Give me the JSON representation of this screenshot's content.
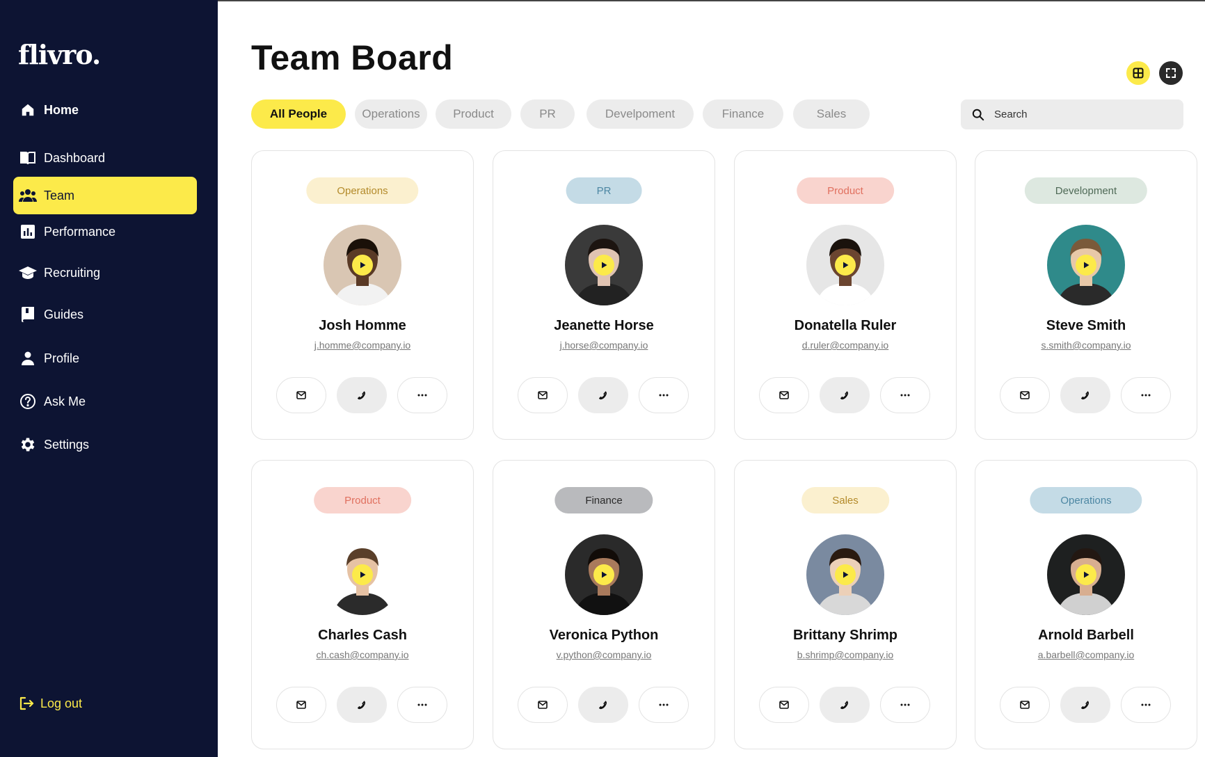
{
  "brand": {
    "logo": "flivro.",
    "accent": "#fcea4a",
    "sidebar_bg": "#0d1433"
  },
  "sidebar": {
    "items": [
      {
        "label": "Home",
        "icon": "home-icon",
        "active": false,
        "bold": true
      },
      {
        "label": "Dashboard",
        "icon": "book-open-icon",
        "active": false
      },
      {
        "label": "Team",
        "icon": "people-icon",
        "active": true
      },
      {
        "label": "Performance",
        "icon": "bar-chart-icon",
        "active": false
      },
      {
        "label": "Recruiting",
        "icon": "graduation-cap-icon",
        "active": false
      },
      {
        "label": "Guides",
        "icon": "book-icon",
        "active": false
      },
      {
        "label": "Profile",
        "icon": "person-icon",
        "active": false
      },
      {
        "label": "Ask Me",
        "icon": "question-icon",
        "active": false
      },
      {
        "label": "Settings",
        "icon": "gear-icon",
        "active": false
      }
    ],
    "logout": "Log out"
  },
  "page": {
    "title": "Team Board"
  },
  "filters": [
    "All People",
    "Operations",
    "Product",
    "PR",
    "Develpoment",
    "Finance",
    "Sales"
  ],
  "search": {
    "placeholder": "Search"
  },
  "people": [
    {
      "name": "Josh Homme",
      "email": "j.homme@company.io",
      "dept": "Operations",
      "tag_bg": "#fbf0cf",
      "tag_fg": "#b38a2a",
      "avatar_bg": "#d9c6b3",
      "skin": "#5a3a26",
      "hair": "#1a1008",
      "shirt": "#f2f2f2"
    },
    {
      "name": "Jeanette Horse",
      "email": "j.horse@company.io",
      "dept": "PR",
      "tag_bg": "#c4dbe6",
      "tag_fg": "#4d87a3",
      "avatar_bg": "#3a3a3a",
      "skin": "#e0c3b2",
      "hair": "#1c1410",
      "shirt": "#222222"
    },
    {
      "name": "Donatella Ruler",
      "email": "d.ruler@company.io",
      "dept": "Product",
      "tag_bg": "#f9d4ce",
      "tag_fg": "#e0705f",
      "avatar_bg": "#e6e6e6",
      "skin": "#6b4530",
      "hair": "#1a120c",
      "shirt": "#ffffff"
    },
    {
      "name": "Steve Smith",
      "email": "s.smith@company.io",
      "dept": "Development",
      "tag_bg": "#dde8e0",
      "tag_fg": "#4f6a57",
      "avatar_bg": "#2f8a8a",
      "skin": "#e8c8a8",
      "hair": "#7a5a3a",
      "shirt": "#2a2a2a"
    },
    {
      "name": "Charles Cash",
      "email": "ch.cash@company.io",
      "dept": "Product",
      "tag_bg": "#f9d4ce",
      "tag_fg": "#e0705f",
      "avatar_bg": "#ffffff",
      "skin": "#e6c2a4",
      "hair": "#5a3f2a",
      "shirt": "#2b2b2b"
    },
    {
      "name": "Veronica Python",
      "email": "v.python@company.io",
      "dept": "Finance",
      "tag_bg": "#b9babd",
      "tag_fg": "#2a2a2a",
      "avatar_bg": "#2a2a2a",
      "skin": "#a97a5c",
      "hair": "#120c08",
      "shirt": "#111111"
    },
    {
      "name": "Brittany Shrimp",
      "email": "b.shrimp@company.io",
      "dept": "Sales",
      "tag_bg": "#fbf0cf",
      "tag_fg": "#b38a2a",
      "avatar_bg": "#7a8aa0",
      "skin": "#ecd0b8",
      "hair": "#2a1a10",
      "shirt": "#d8d8d8"
    },
    {
      "name": "Arnold Barbell",
      "email": "a.barbell@company.io",
      "dept": "Operations",
      "tag_bg": "#c4dbe6",
      "tag_fg": "#4d87a3",
      "avatar_bg": "#1e2020",
      "skin": "#d8ae90",
      "hair": "#231812",
      "shirt": "#d0d0d0"
    }
  ]
}
